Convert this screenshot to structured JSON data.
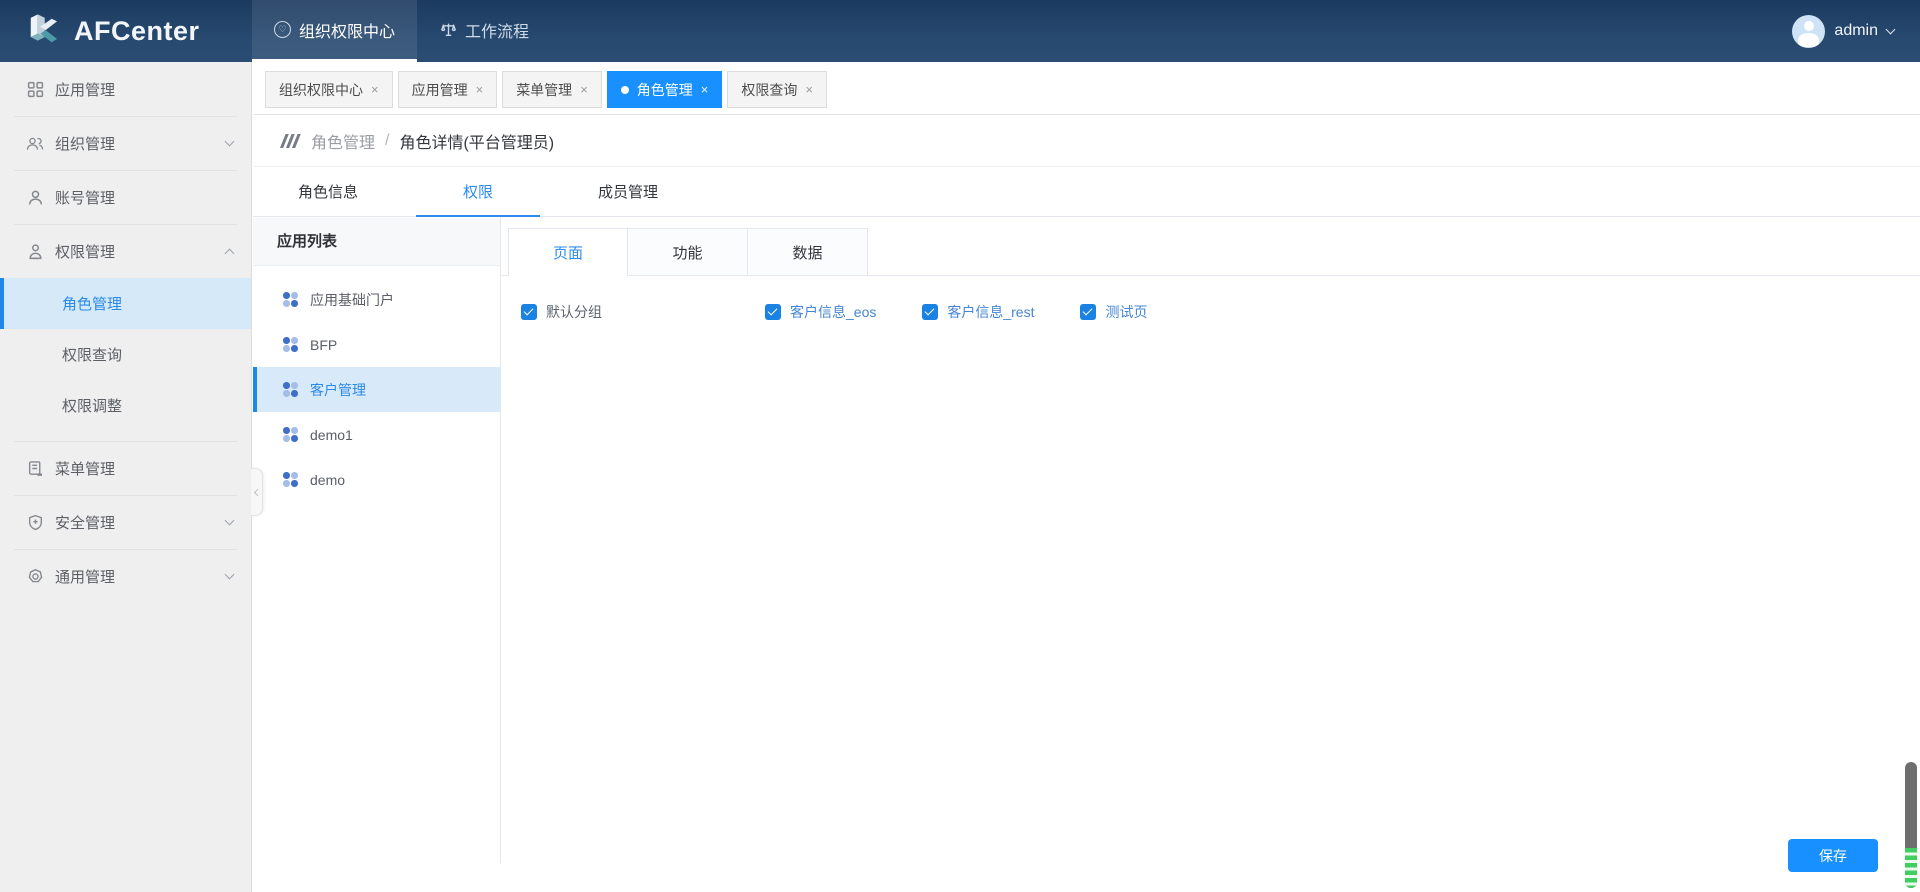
{
  "topbar": {
    "logo_text": "AFCenter",
    "nav": [
      {
        "label": "组织权限中心",
        "icon": "heart-circle-icon",
        "active": true
      },
      {
        "label": "工作流程",
        "icon": "workflow-icon",
        "active": false
      }
    ],
    "user": {
      "name": "admin"
    }
  },
  "sidebar": {
    "items": [
      {
        "label": "应用管理",
        "icon": "grid-icon"
      },
      {
        "label": "组织管理",
        "icon": "people-icon",
        "chevron": "down"
      },
      {
        "label": "账号管理",
        "icon": "person-icon"
      },
      {
        "label": "权限管理",
        "icon": "person-badge-icon",
        "chevron": "up",
        "expanded": true,
        "children": [
          {
            "label": "角色管理",
            "active": true
          },
          {
            "label": "权限查询",
            "active": false
          },
          {
            "label": "权限调整",
            "active": false
          }
        ]
      },
      {
        "label": "菜单管理",
        "icon": "document-icon"
      },
      {
        "label": "安全管理",
        "icon": "shield-plus-icon",
        "chevron": "down"
      },
      {
        "label": "通用管理",
        "icon": "gear-icon",
        "chevron": "down"
      }
    ]
  },
  "page_tabs": [
    {
      "label": "组织权限中心",
      "active": false
    },
    {
      "label": "应用管理",
      "active": false
    },
    {
      "label": "菜单管理",
      "active": false
    },
    {
      "label": "角色管理",
      "active": true
    },
    {
      "label": "权限查询",
      "active": false
    }
  ],
  "breadcrumb": {
    "parent": "角色管理",
    "separator": "/",
    "current": "角色详情(平台管理员)"
  },
  "detail_tabs": [
    {
      "label": "角色信息",
      "active": false
    },
    {
      "label": "权限",
      "active": true
    },
    {
      "label": "成员管理",
      "active": false
    }
  ],
  "app_panel": {
    "title": "应用列表",
    "items": [
      {
        "label": "应用基础门户",
        "active": false
      },
      {
        "label": "BFP",
        "active": false
      },
      {
        "label": "客户管理",
        "active": true
      },
      {
        "label": "demo1",
        "active": false
      },
      {
        "label": "demo",
        "active": false
      }
    ]
  },
  "perm_tabs": [
    {
      "label": "页面",
      "active": true
    },
    {
      "label": "功能",
      "active": false
    },
    {
      "label": "数据",
      "active": false
    }
  ],
  "checkboxes": [
    {
      "label": "默认分组",
      "checked": true,
      "link": false
    },
    {
      "label": "客户信息_eos",
      "checked": true,
      "link": true
    },
    {
      "label": "客户信息_rest",
      "checked": true,
      "link": true
    },
    {
      "label": "测试页",
      "checked": true,
      "link": true
    }
  ],
  "save_label": "保存",
  "ui": {
    "close_glyph": "×",
    "heart_glyph": "♡"
  },
  "colors": {
    "accent": "#1890ff",
    "topbar": "#24466e",
    "checkbox": "#1a82e2",
    "link_text": "#4586d2",
    "selected_row_bg": "#d8eafa",
    "sidebar_bg": "#efefef",
    "scroll_green": "#3ecf5e"
  }
}
